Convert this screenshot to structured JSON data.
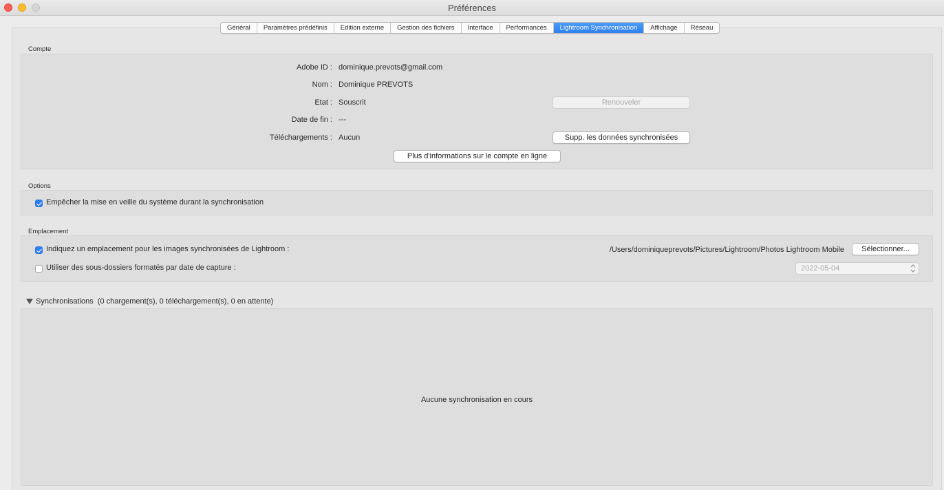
{
  "window": {
    "title": "Préférences"
  },
  "tabs": [
    {
      "label": "Général",
      "active": false
    },
    {
      "label": "Paramètres prédéfinis",
      "active": false
    },
    {
      "label": "Edition externe",
      "active": false
    },
    {
      "label": "Gestion des fichiers",
      "active": false
    },
    {
      "label": "Interface",
      "active": false
    },
    {
      "label": "Performances",
      "active": false
    },
    {
      "label": "Lightroom Synchronisation",
      "active": true
    },
    {
      "label": "Affichage",
      "active": false
    },
    {
      "label": "Réseau",
      "active": false
    }
  ],
  "account": {
    "section_label": "Compte",
    "adobe_id_label": "Adobe ID :",
    "adobe_id_value": "dominique.prevots@gmail.com",
    "name_label": "Nom :",
    "name_value": "Dominique PREVOTS",
    "state_label": "Etat :",
    "state_value": "Souscrit",
    "end_date_label": "Date de fin :",
    "end_date_value": "---",
    "downloads_label": "Téléchargements :",
    "downloads_value": "Aucun",
    "renew_button": "Renouveler",
    "delete_button": "Supp. les données synchronisées",
    "more_info_button": "Plus d'informations sur le compte en ligne"
  },
  "options": {
    "section_label": "Options",
    "prevent_sleep_label": "Empêcher la mise en veille du système durant la synchronisation",
    "prevent_sleep_checked": true
  },
  "location": {
    "section_label": "Emplacement",
    "specify_location_label": "Indiquez un emplacement pour les images synchronisées de Lightroom :",
    "specify_location_checked": true,
    "path": "/Users/dominiqueprevots/Pictures/Lightroom/Photos Lightroom Mobile",
    "select_button": "Sélectionner...",
    "subfolders_label": "Utiliser des sous-dossiers formatés par date de capture :",
    "subfolders_checked": false,
    "date_format_value": "2022-05-04"
  },
  "syncs": {
    "title": "Synchronisations",
    "stats": "(0 chargement(s), 0 téléchargement(s), 0 en attente)",
    "empty_message": "Aucune synchronisation en cours"
  },
  "colors": {
    "accent": "#2f7fef",
    "window_bg": "#ececec",
    "panel_bg": "#dedede"
  },
  "icons": [
    "close-window-icon",
    "minimize-window-icon",
    "maximize-window-icon",
    "checkmark-icon",
    "disclosure-triangle-icon",
    "updown-arrows-icon"
  ]
}
